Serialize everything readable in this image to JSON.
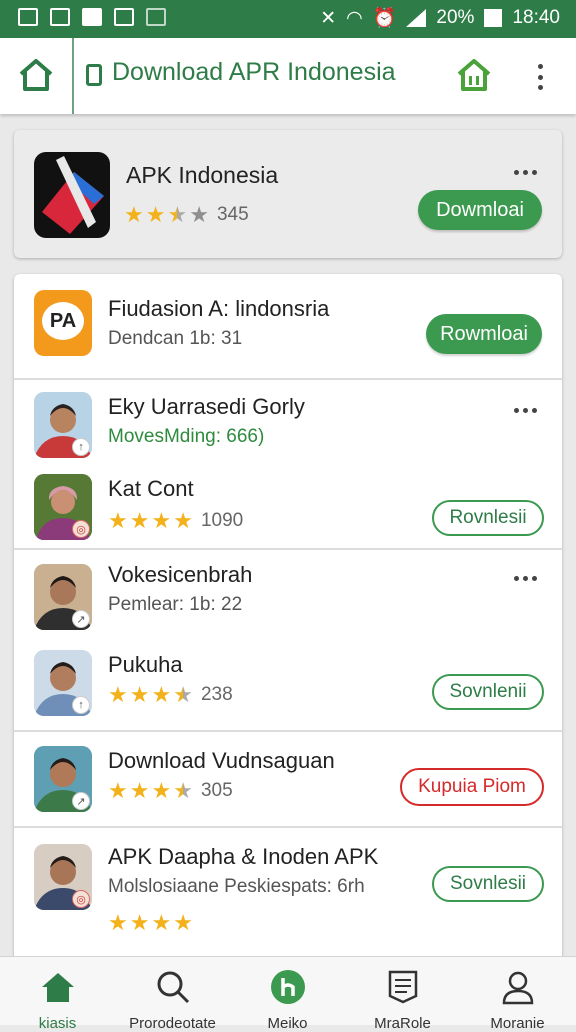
{
  "status_bar": {
    "battery": "20%",
    "time": "18:40"
  },
  "app_bar": {
    "title": "Download APR Indonesia"
  },
  "featured": {
    "name": "APK Indonesia",
    "rating": 2.5,
    "rating_count": "345",
    "button": "Dowmloai"
  },
  "items": [
    {
      "name": "Fiudasion A: lindonsria",
      "meta": "Dendcan 1b: 31",
      "button": "Rowmloai",
      "button_style": "filled"
    },
    {
      "name": "Eky Uarrasedi Gorly",
      "meta": "MovesMding: 666)",
      "meta_style": "green"
    },
    {
      "name": "Kat Cont",
      "rating": 4,
      "rating_count": "1090",
      "button": "Rovnlesii",
      "button_style": "outline"
    },
    {
      "name": "Vokesicenbrah",
      "meta": "Pemlear: 1b: 22"
    },
    {
      "name": "Pukuha",
      "rating": 3.5,
      "rating_count": "238",
      "button": "Sovnlenii",
      "button_style": "outline"
    },
    {
      "name": "Download Vudnsaguan",
      "rating": 3.5,
      "rating_count": "305",
      "button": "Kupuia Piom",
      "button_style": "red"
    },
    {
      "name": "APK Daapha & Inoden APK",
      "meta": "Molslosiaane Peskiespats: 6rh",
      "rating": 4,
      "button": "Sovnlesii",
      "button_style": "outline"
    }
  ],
  "bottom_nav": [
    {
      "label": "kiasis",
      "icon": "home-icon",
      "active": true
    },
    {
      "label": "Prorodeotate",
      "icon": "search-icon"
    },
    {
      "label": "Meiko",
      "icon": "brand-icon"
    },
    {
      "label": "MraRole",
      "icon": "list-icon"
    },
    {
      "label": "Moranie",
      "icon": "profile-icon"
    }
  ],
  "colors": {
    "primary": "#2e7c47",
    "button_green": "#3b9a4f",
    "red": "#d52a2a",
    "star": "#f3b21b"
  }
}
